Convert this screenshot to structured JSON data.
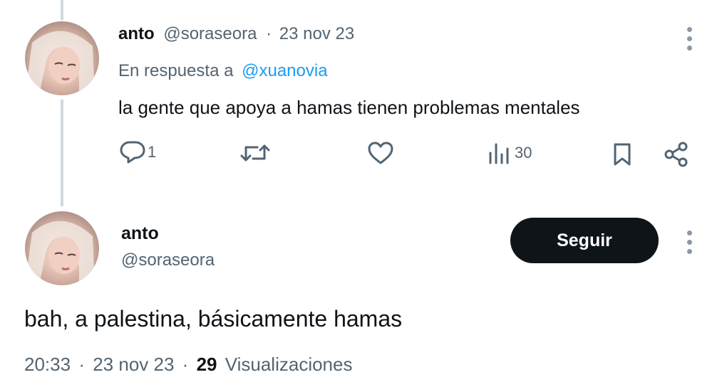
{
  "reply_tweet": {
    "display_name": "anto",
    "handle": "@soraseora",
    "separator": "·",
    "date": "23 nov 23",
    "reply_prefix": "En respuesta a",
    "reply_to": "@xuanovia",
    "text": "la gente que apoya a hamas tienen problemas mentales",
    "reply_count": "1",
    "views_count": "30",
    "icons": [
      "reply-icon",
      "retweet-icon",
      "like-icon",
      "views-icon",
      "bookmark-icon",
      "share-icon",
      "more-icon"
    ]
  },
  "main_tweet": {
    "display_name": "anto",
    "handle": "@soraseora",
    "follow_label": "Seguir",
    "text": "bah, a palestina, básicamente hamas",
    "time": "20:33",
    "separator": "·",
    "date": "23 nov 23",
    "views_count": "29",
    "views_label": "Visualizaciones"
  },
  "colors": {
    "text": "#0f1419",
    "secondary": "#536471",
    "link": "#1d9bf0",
    "button_bg": "#0f1419",
    "thread_line": "#cfd9de"
  }
}
